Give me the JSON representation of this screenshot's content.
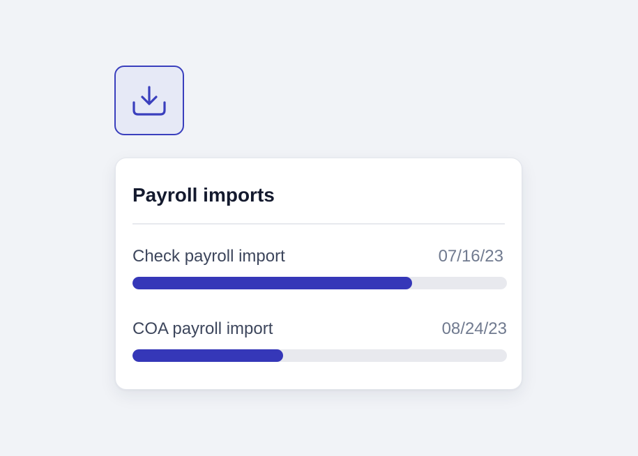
{
  "card": {
    "title": "Payroll imports"
  },
  "imports": [
    {
      "name": "Check payroll import",
      "date": "07/16/23",
      "progress": 0.746
    },
    {
      "name": "COA payroll import",
      "date": "08/24/23",
      "progress": 0.402
    }
  ],
  "colors": {
    "accent": "#3537b8",
    "icon_border": "#3a3fbd",
    "icon_background": "#e6e9f6",
    "track": "#e8e9ee",
    "background": "#f1f3f7"
  },
  "icons": {
    "download": "download-icon"
  }
}
